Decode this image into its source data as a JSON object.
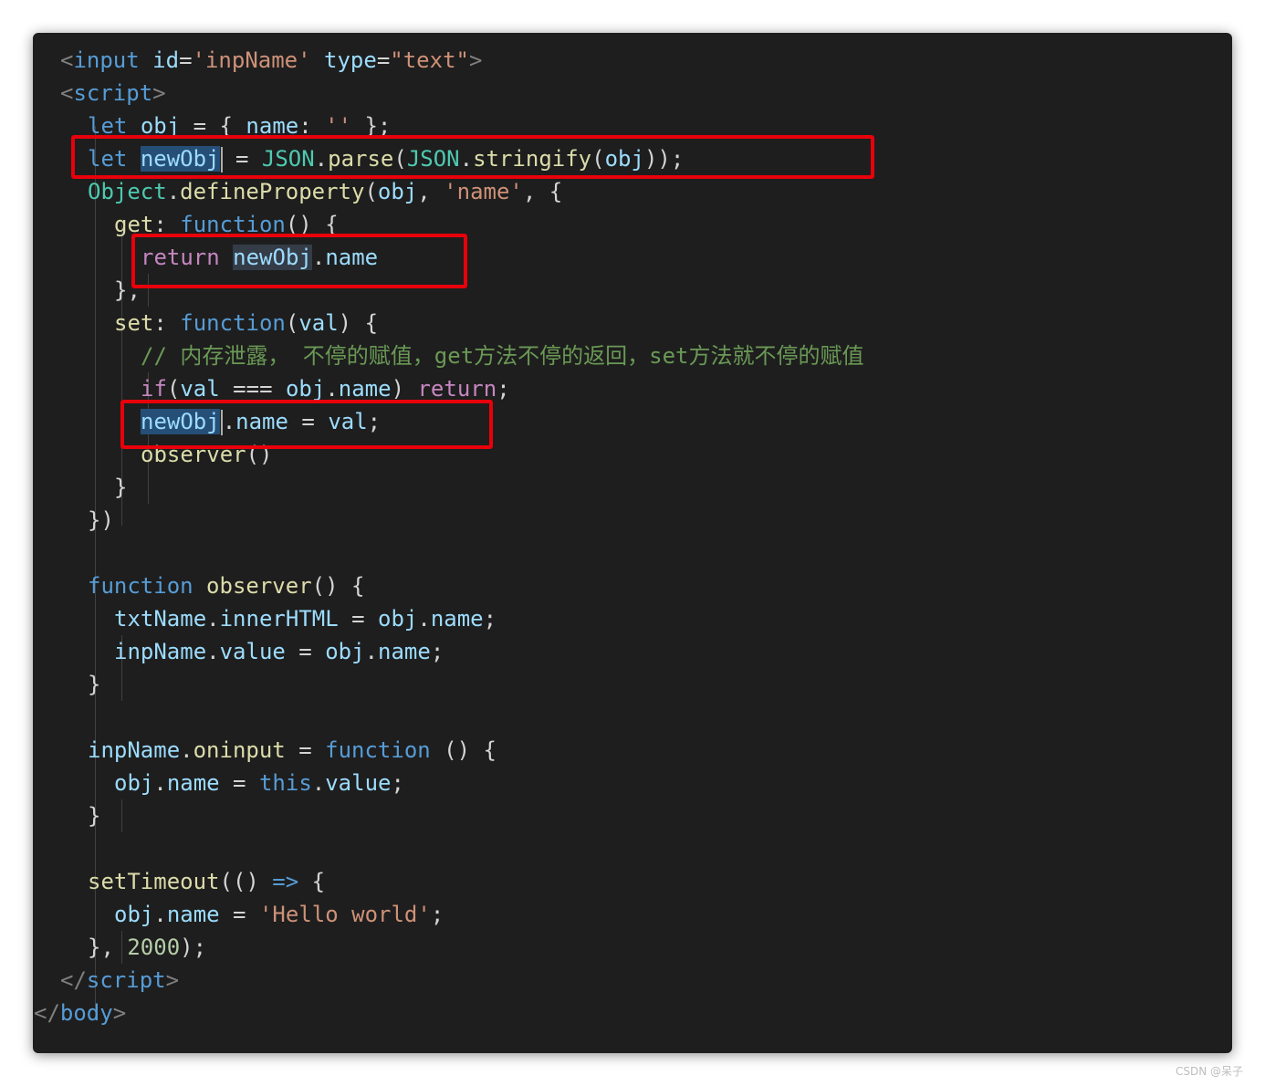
{
  "code": {
    "l1": {
      "a": "<",
      "b": "input",
      "c": "id",
      "d": "=",
      "e": "'inpName'",
      "f": "type",
      "g": "=",
      "h": "\"text\"",
      "i": ">"
    },
    "l2": {
      "a": "<",
      "b": "script",
      "c": ">"
    },
    "l3": {
      "a": "let",
      "b": "obj",
      "c": " = { ",
      "d": "name",
      "e": ": ",
      "f": "''",
      "g": " };"
    },
    "l4": {
      "a": "let",
      "b": "newObj",
      "c": " = ",
      "d": "JSON",
      "e": ".",
      "f": "parse",
      "g": "(",
      "h": "JSON",
      "i": ".",
      "j": "stringify",
      "k": "(",
      "l": "obj",
      "m": "));"
    },
    "l5": {
      "a": "Object",
      "b": ".",
      "c": "defineProperty",
      "d": "(",
      "e": "obj",
      "f": ", ",
      "g": "'name'",
      "h": ", {"
    },
    "l6": {
      "a": "get",
      "b": ": ",
      "c": "function",
      "d": "() {"
    },
    "l7": {
      "a": "return",
      "b": "newObj",
      "c": ".",
      "d": "name"
    },
    "l8": {
      "a": "},"
    },
    "l9": {
      "a": "set",
      "b": ": ",
      "c": "function",
      "d": "(",
      "e": "val",
      "f": ") {"
    },
    "l10": {
      "a": "// 内存泄露， 不停的赋值，get方法不停的返回，set方法就不停的赋值"
    },
    "l11": {
      "a": "if",
      "b": "(",
      "c": "val",
      "d": " === ",
      "e": "obj",
      "f": ".",
      "g": "name",
      "h": ") ",
      "i": "return",
      ";": ";",
      "j": ";"
    },
    "l12": {
      "a": "newObj",
      "b": ".",
      "c": "name",
      "d": " = ",
      "e": "val",
      "f": ";"
    },
    "l13": {
      "a": "observer",
      "b": "()"
    },
    "l14": {
      "a": "}"
    },
    "l15": {
      "a": "})"
    },
    "l17": {
      "a": "function",
      "b": "observer",
      "c": "() {"
    },
    "l18": {
      "a": "txtName",
      "b": ".",
      "c": "innerHTML",
      "d": " = ",
      "e": "obj",
      "f": ".",
      "g": "name",
      "h": ";"
    },
    "l19": {
      "a": "inpName",
      "b": ".",
      "c": "value",
      "d": " = ",
      "e": "obj",
      "f": ".",
      "g": "name",
      "h": ";"
    },
    "l20": {
      "a": "}"
    },
    "l22": {
      "a": "inpName",
      "b": ".",
      "c": "oninput",
      "d": " = ",
      "e": "function",
      "f": " () {"
    },
    "l23": {
      "a": "obj",
      "b": ".",
      "c": "name",
      "d": " = ",
      "e": "this",
      "f": ".",
      "g": "value",
      "h": ";"
    },
    "l24": {
      "a": "}"
    },
    "l26": {
      "a": "setTimeout",
      "b": "(() ",
      "c": "=>",
      "d": " {"
    },
    "l27": {
      "a": "obj",
      "b": ".",
      "c": "name",
      "d": " = ",
      "e": "'Hello world'",
      "f": ";"
    },
    "l28": {
      "a": "}, ",
      "b": "2000",
      "c": ");"
    },
    "l29": {
      "a": "</",
      "b": "script",
      "c": ">"
    },
    "l30": {
      "a": "</",
      "b": "body",
      "c": ">"
    }
  },
  "colors": {
    "background": "#1e1e1e",
    "highlight_box": "#e8000b",
    "selection": "#264f78"
  },
  "watermark": "CSDN @呆子"
}
